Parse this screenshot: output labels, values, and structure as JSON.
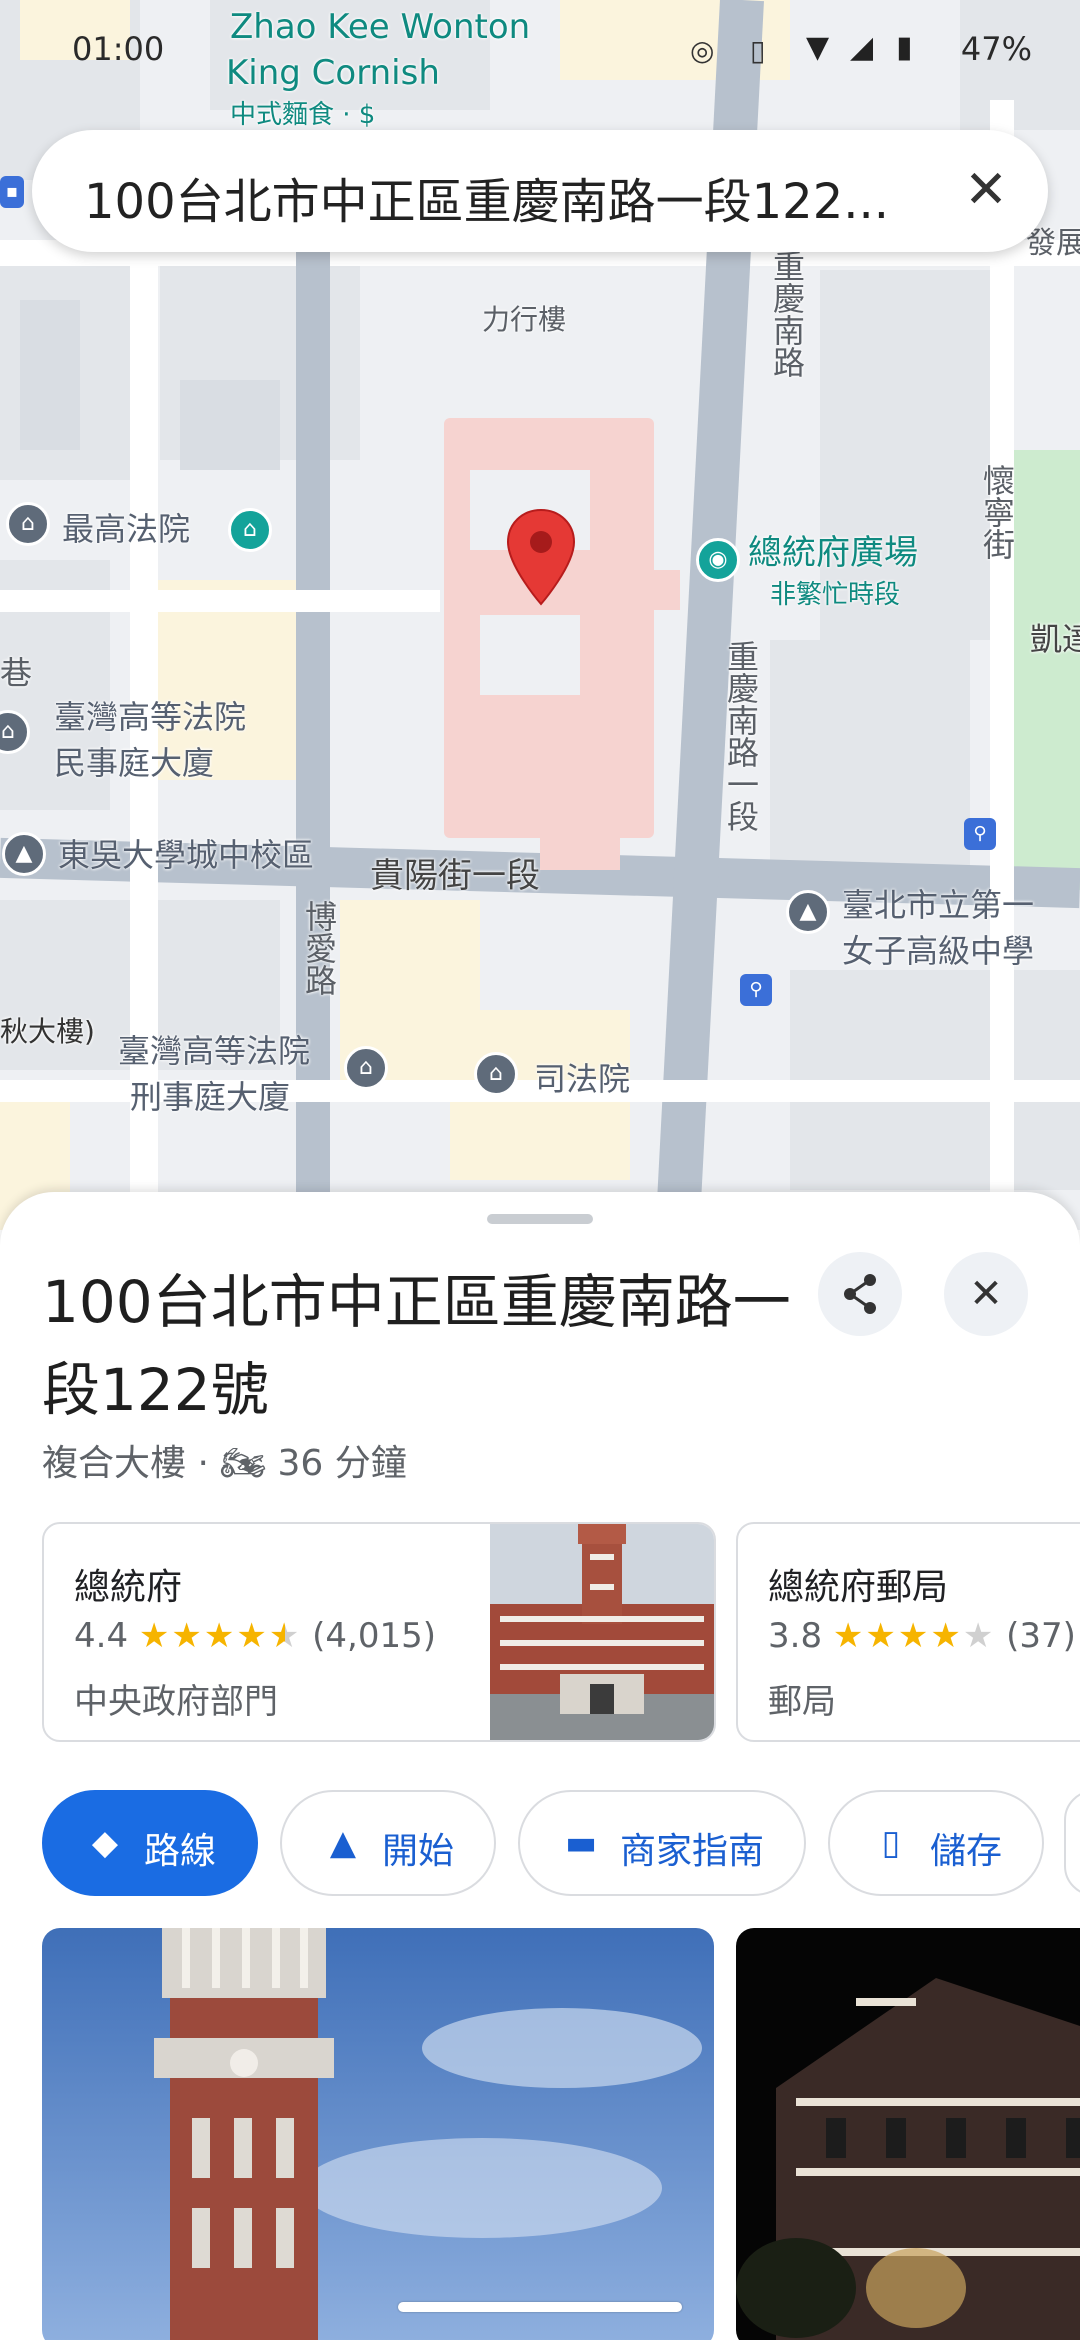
{
  "status_bar": {
    "time": "01:00",
    "battery": "47%"
  },
  "search": {
    "query": "100台北市中正區重慶南路一段122..."
  },
  "map": {
    "labels": {
      "top_place_1": "Zhao Kee Wonton",
      "top_place_2": "King Cornish",
      "top_place_3": "中式麵食 · $",
      "building_lixing": "力行樓",
      "supreme_court": "最高法院",
      "plaza": "總統府廣場",
      "plaza_sub": "非繁忙時段",
      "high_court_civil_1": "臺灣高等法院",
      "high_court_civil_2": "民事庭大廈",
      "soochow": "東吳大學城中校區",
      "guiyang": "貴陽街一段",
      "first_girls_1": "臺北市立第一",
      "first_girls_2": "女子高級中學",
      "high_court_criminal_1": "臺灣高等法院",
      "high_court_criminal_2": "刑事庭大廈",
      "judicial_yuan": "司法院",
      "boai_rd": "博愛路",
      "chongqing_s_1": "重慶南路一段",
      "chongqing_s_top": "重慶南路",
      "huaining_st": "懷寧街",
      "lane_left": "巷",
      "partial_left": "秋大樓)",
      "partial_right_1": "凱達",
      "partial_right_2": "發展"
    }
  },
  "place": {
    "title": "100台北市中正區重慶南路一段122號",
    "type": "複合大樓",
    "separator": "·",
    "travel_time": "36 分鐘"
  },
  "nearby": [
    {
      "name": "總統府",
      "rating": "4.4",
      "stars_full": 4,
      "stars_half": 1,
      "reviews": "(4,015)",
      "category": "中央政府部門"
    },
    {
      "name": "總統府郵局",
      "rating": "3.8",
      "stars_full": 4,
      "stars_half": 0,
      "reviews": "(37)",
      "category": "郵局"
    }
  ],
  "actions": {
    "route": "路線",
    "start": "開始",
    "directory": "商家指南",
    "save": "儲存"
  }
}
